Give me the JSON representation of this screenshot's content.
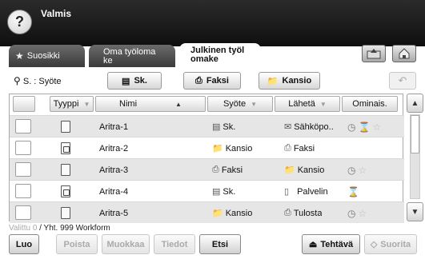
{
  "header": {
    "status": "Valmis",
    "help_symbol": "?"
  },
  "tabs": [
    {
      "label": "Suosikki",
      "icon": "star-icon"
    },
    {
      "label_line1": "Oma työloma",
      "label_line2": "ke"
    },
    {
      "label_line1": "Julkinen työl",
      "label_line2": "omake",
      "active": true
    }
  ],
  "corner_buttons": [
    {
      "icon": "folder-up-icon"
    },
    {
      "icon": "home-icon"
    }
  ],
  "toolbar": {
    "search_label": "S. : Syöte",
    "filters": [
      {
        "label": "Sk.",
        "icon": "scanner-icon"
      },
      {
        "label": "Faksi",
        "icon": "fax-icon"
      },
      {
        "label": "Kansio",
        "icon": "folder-icon"
      }
    ],
    "undo_symbol": "↶"
  },
  "table": {
    "columns": [
      "Tyyppi",
      "Nimi",
      "Syöte",
      "Lähetä",
      "Ominais."
    ],
    "sort_arrow": "▲",
    "dropdown_arrow": "▼",
    "rows": [
      {
        "type": "doc",
        "name": "Aritra-1",
        "input": "Sk.",
        "input_icon": "scanner-icon",
        "send": "Sähköpo..",
        "send_icon": "email-icon",
        "options": [
          "clock-icon",
          "hourglass-icon",
          "star-icon"
        ]
      },
      {
        "type": "locked",
        "name": "Aritra-2",
        "input": "Kansio",
        "input_icon": "folder-icon",
        "send": "Faksi",
        "send_icon": "fax-icon",
        "options": []
      },
      {
        "type": "doc",
        "name": "Aritra-3",
        "input": "Faksi",
        "input_icon": "fax-icon",
        "send": "Kansio",
        "send_icon": "folder-icon",
        "options": [
          "clock-icon",
          "star-icon"
        ]
      },
      {
        "type": "locked",
        "name": "Aritra-4",
        "input": "Sk.",
        "input_icon": "scanner-icon",
        "send": "Palvelin",
        "send_icon": "server-icon",
        "options": [
          "hourglass-icon"
        ]
      },
      {
        "type": "doc",
        "name": "Aritra-5",
        "input": "Kansio",
        "input_icon": "folder-icon",
        "send": "Tulosta",
        "send_icon": "printer-icon",
        "options": [
          "clock-icon",
          "star-icon"
        ]
      }
    ]
  },
  "footer": {
    "selected": "Valittu 0",
    "total": "/ Yht. 999 Workform",
    "buttons": {
      "create": "Luo",
      "delete": "Poista",
      "edit": "Muokkaa",
      "details": "Tiedot",
      "search": "Etsi",
      "tasks": "Tehtävä",
      "run": "Suorita"
    }
  }
}
